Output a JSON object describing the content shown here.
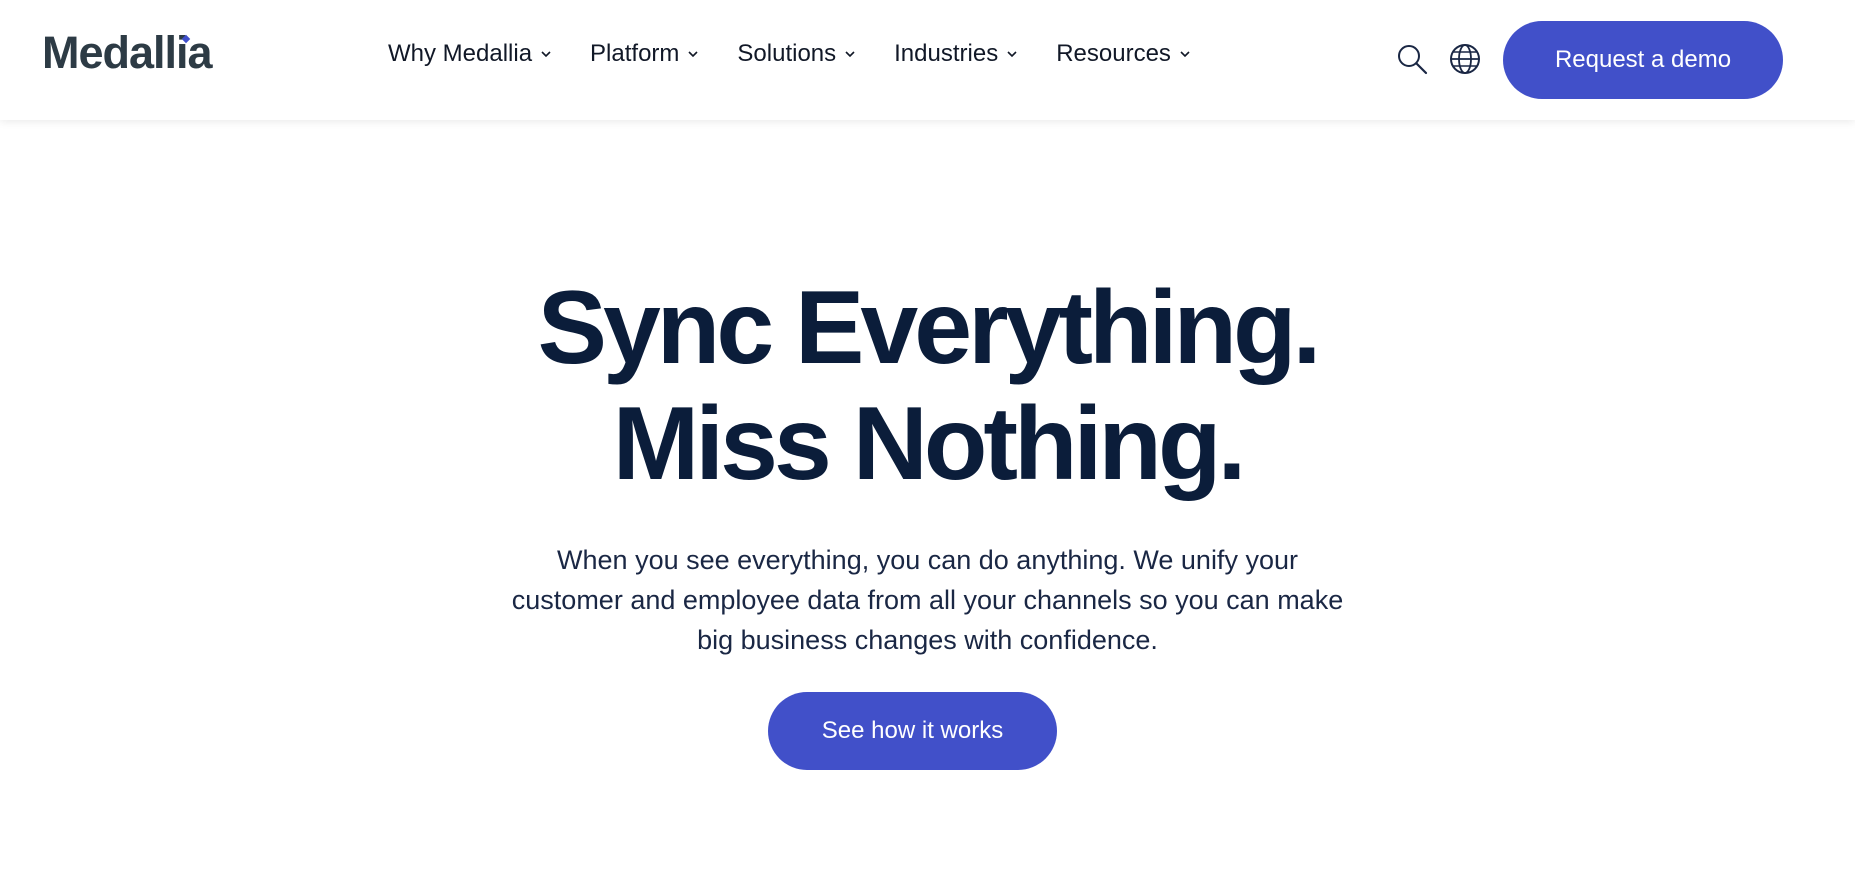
{
  "brand": {
    "logo_text": "Medallia",
    "accent_color": "#4150c9",
    "text_color": "#0b1d3a"
  },
  "nav": {
    "items": [
      {
        "label": "Why Medallia",
        "icon": "chevron-down-icon"
      },
      {
        "label": "Platform",
        "icon": "chevron-down-icon"
      },
      {
        "label": "Solutions",
        "icon": "chevron-down-icon"
      },
      {
        "label": "Industries",
        "icon": "chevron-down-icon"
      },
      {
        "label": "Resources",
        "icon": "chevron-down-icon"
      }
    ]
  },
  "header_actions": {
    "search_icon": "search-icon",
    "language_icon": "globe-icon",
    "cta_label": "Request a demo"
  },
  "hero": {
    "title_line1": "Sync Everything.",
    "title_line2": "Miss Nothing.",
    "subtitle": "When you see everything, you can do anything. We unify your customer and employee data from all your channels so you can make big business changes with confidence.",
    "cta_label": "See how it works"
  }
}
